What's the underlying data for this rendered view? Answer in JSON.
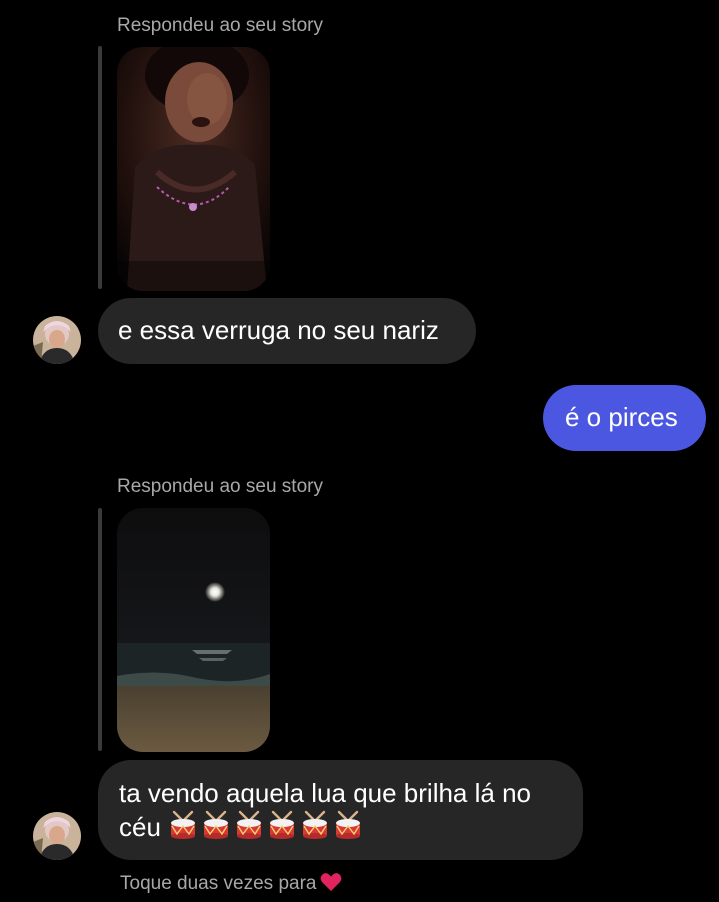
{
  "messages": [
    {
      "type": "story_reply",
      "caption": "Respondeu ao seu story",
      "text": "e essa verruga no seu nariz"
    },
    {
      "type": "outgoing",
      "text": "é o pirces"
    },
    {
      "type": "story_reply",
      "caption": "Respondeu ao seu story",
      "text": "ta vendo aquela lua que brilha lá no céu",
      "emoji_count": 6,
      "emoji_icon": "drum-icon"
    }
  ],
  "hint": {
    "text": "Toque duas vezes para",
    "icon": "heart-icon"
  },
  "colors": {
    "background": "#000000",
    "incoming_bubble": "#262626",
    "outgoing_bubble": "#4b57e0",
    "caption_text": "#a8a8a8",
    "heart": "#e0245e"
  }
}
